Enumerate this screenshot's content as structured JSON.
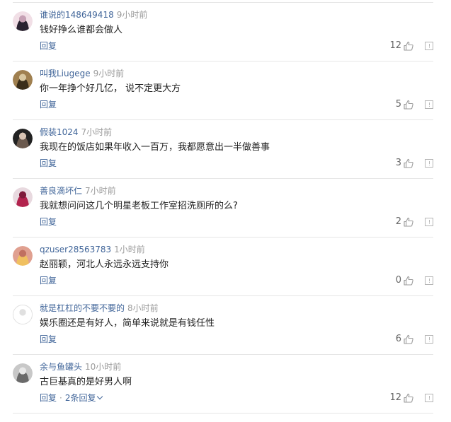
{
  "comments": [
    {
      "author": "谁说的148649418",
      "time": "9小时前",
      "content": "钱好挣么谁都会做人",
      "reply_label": "回复",
      "likes": "12",
      "avatar_colors": [
        "#f1dfe6",
        "#2a2230",
        "#c6a0b4"
      ]
    },
    {
      "author": "叫我Liugege",
      "time": "9小时前",
      "content": "你一年挣个好几亿， 说不定更大方",
      "reply_label": "回复",
      "likes": "5",
      "avatar_colors": [
        "#a08050",
        "#3b2e1a",
        "#d9c7a0"
      ]
    },
    {
      "author": "假装1024",
      "time": "7小时前",
      "content": "我现在的饭店如果年收入一百万，我都愿意出一半做善事",
      "reply_label": "回复",
      "likes": "3",
      "avatar_colors": [
        "#222222",
        "#6b5a4e",
        "#d8c4b4"
      ]
    },
    {
      "author": "善良滴坏仁",
      "time": "7小时前",
      "content": "我就想问问这几个明星老板工作室招洗厕所的么?",
      "reply_label": "回复",
      "likes": "2",
      "avatar_colors": [
        "#e8d9df",
        "#b2234d",
        "#7e1a3a"
      ]
    },
    {
      "author": "qzuser28563783",
      "time": "1小时前",
      "content": "赵丽颖，河北人永远永远支持你",
      "reply_label": "回复",
      "likes": "0",
      "avatar_colors": [
        "#e0a090",
        "#f0c060",
        "#c07060"
      ]
    },
    {
      "author": "就是杠杠的不要不要的",
      "time": "8小时前",
      "content": "娱乐圈还是有好人，简单来说就是有钱任性",
      "reply_label": "回复",
      "likes": "6",
      "avatar_colors": [
        "#ffffff",
        "#ffffff",
        "#e0e0e0"
      ]
    },
    {
      "author": "余与鱼罐头",
      "time": "10小时前",
      "content": "古巨基真的是好男人啊",
      "reply_label": "回复",
      "likes": "12",
      "more_replies": "2条回复",
      "avatar_colors": [
        "#c8c8c8",
        "#6a6a6a",
        "#e8e8e8"
      ]
    }
  ],
  "colors": {
    "author": "#406599",
    "time": "#9b9b9b",
    "content": "#222222",
    "divider": "#e6e6e6"
  },
  "icons": {
    "like": "thumbs-up-icon",
    "report": "report-icon",
    "more": "chevron-down-icon"
  }
}
